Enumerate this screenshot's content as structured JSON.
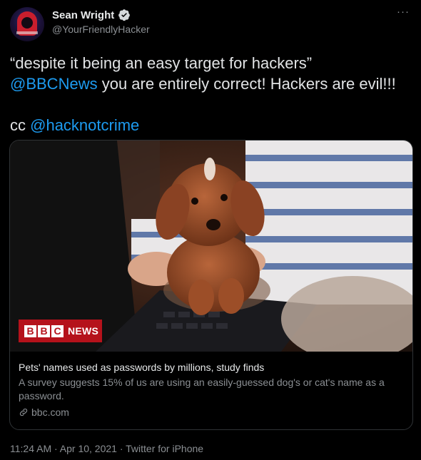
{
  "author": {
    "display_name": "Sean Wright",
    "handle": "@YourFriendlyHacker",
    "verified": true,
    "avatar_icon": "hooded-hacker-avatar"
  },
  "menu_icon": "more-horizontal-icon",
  "tweet": {
    "line1": "“despite it being an easy target for hackers”",
    "mention1": "@BBCNews",
    "line2_rest": " you are entirely correct! Hackers are evil!!!",
    "cc": "cc ",
    "mention2": "@hacknotcrime"
  },
  "card": {
    "badge_letters": [
      "B",
      "B",
      "C"
    ],
    "badge_text": "NEWS",
    "title": "Pets' names used as passwords by millions, study finds",
    "description": "A survey suggests 15% of us are using an easily-guessed dog's or cat's name as a password.",
    "domain": "bbc.com",
    "image_subject": "puppy-held-near-laptop-photo"
  },
  "meta": {
    "timestamp": "11:24 AM · Apr 10, 2021 · Twitter for iPhone"
  },
  "colors": {
    "background": "#000000",
    "link": "#1d9bf0",
    "secondary_text": "#8b8f93",
    "bbc_red": "#b5121b"
  }
}
